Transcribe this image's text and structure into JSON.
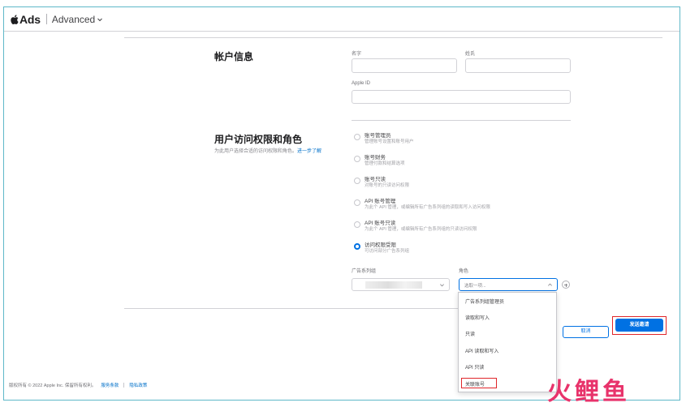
{
  "header": {
    "brand": "Ads",
    "mode": "Advanced"
  },
  "account_info": {
    "title": "帐户信息",
    "first_name_label": "名字",
    "last_name_label": "姓氏",
    "apple_id_label": "Apple ID",
    "first_name_value": "",
    "last_name_value": "",
    "apple_id_value": ""
  },
  "access": {
    "title": "用户访问权限和角色",
    "description": "为此用户选择合适的访问权限和角色。",
    "learn_more": "进一步了解",
    "roles": [
      {
        "title": "账号管理员",
        "sub": "管理账号设置和账号用户",
        "selected": false
      },
      {
        "title": "账号财务",
        "sub": "管理付款和结算选项",
        "selected": false
      },
      {
        "title": "账号只读",
        "sub": "对账号的只读访问权限",
        "selected": false
      },
      {
        "title": "API 账号管理",
        "sub": "为此个 API 管理，或编辑所有广告系列组的读取和写入访问权限",
        "selected": false
      },
      {
        "title": "API 账号只读",
        "sub": "为此个 API 管理，或编辑所有广告系列组的只读访问权限",
        "selected": false
      },
      {
        "title": "访问权限受限",
        "sub": "可访问部分广告系列组",
        "selected": true
      }
    ],
    "campaign_group_label": "广告系列组",
    "role_label": "角色",
    "role_placeholder": "选取一项...",
    "role_options": [
      "广告系列组管理员",
      "读取和写入",
      "只读",
      "API 读取和写入",
      "API 只读",
      "关联账号"
    ]
  },
  "actions": {
    "cancel": "取消",
    "send": "发送邀请"
  },
  "footer": {
    "copyright": "版权所有 © 2022 Apple Inc. 保留所有权利。",
    "terms": "服务条款",
    "privacy": "隐私政策"
  },
  "watermark": {
    "chars": [
      "火",
      "鲤",
      "鱼"
    ]
  },
  "colors": {
    "accent": "#0071e3",
    "highlight": "#e0262a",
    "frame": "#5fb8c8"
  }
}
